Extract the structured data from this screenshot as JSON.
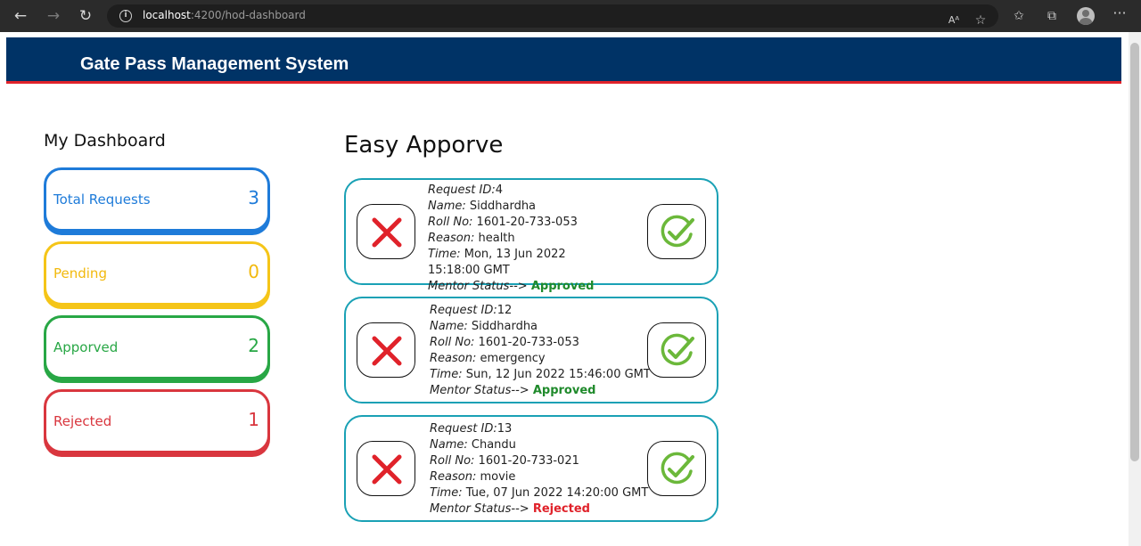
{
  "browser": {
    "url_host": "localhost",
    "url_path": ":4200/hod-dashboard",
    "read_aloud_label": "Aᴬ"
  },
  "header": {
    "title": "Gate Pass Management System"
  },
  "sidebar": {
    "title": "My Dashboard",
    "cards": [
      {
        "label": "Total Requests",
        "count": "3",
        "color": "#1e7bd9"
      },
      {
        "label": "Pending",
        "count": "0",
        "color": "#f5c518"
      },
      {
        "label": "Apporved",
        "count": "2",
        "color": "#28a745"
      },
      {
        "label": "Rejected",
        "count": "1",
        "color": "#d9363e"
      }
    ]
  },
  "main": {
    "title": "Easy Apporve",
    "field_labels": {
      "request_id": "Request ID:",
      "name": "Name:",
      "roll_no": "Roll No:",
      "reason": "Reason:",
      "time": "Time:",
      "mentor_status": "Mentor Status-->"
    },
    "requests": [
      {
        "request_id": "4",
        "name": "Siddhardha",
        "roll_no": "1601-20-733-053",
        "reason": "health",
        "time": "Mon, 13 Jun 2022 15:18:00 GMT",
        "mentor_status": "Approved"
      },
      {
        "request_id": "12",
        "name": "Siddhardha",
        "roll_no": "1601-20-733-053",
        "reason": "emergency",
        "time": "Sun, 12 Jun 2022 15:46:00 GMT",
        "mentor_status": "Approved"
      },
      {
        "request_id": "13",
        "name": "Chandu",
        "roll_no": "1601-20-733-021",
        "reason": "movie",
        "time": "Tue, 07 Jun 2022 14:20:00 GMT",
        "mentor_status": "Rejected"
      }
    ]
  }
}
